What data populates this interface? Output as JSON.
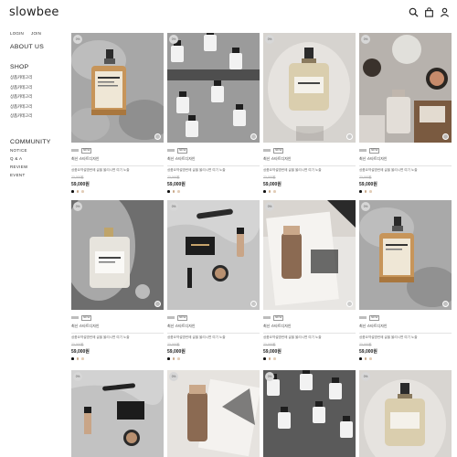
{
  "header": {
    "logo": "slowbee",
    "icons": [
      "search-icon",
      "bag-icon",
      "user-icon"
    ]
  },
  "sidebar": {
    "auth": {
      "login": "LOGIN",
      "join": "JOIN"
    },
    "about": "ABOUT US",
    "shop_title": "SHOP",
    "categories": [
      "상품카테고리",
      "상품카테고리",
      "상품카테고리",
      "상품카테고리",
      "상품카테고리"
    ],
    "community_title": "COMMUNITY",
    "community": [
      "NOTICE",
      "Q & A",
      "REVIEW",
      "EVENT"
    ]
  },
  "products": [
    {
      "badge": "0%",
      "tag": "NEW",
      "name": "최신 스타트디자인",
      "desc": "상품요약설명란에 글을 올리시면 여기 노출",
      "orig": "73,000원",
      "price": "59,000원",
      "swatches": [
        "#111111",
        "#c9a98a",
        "#e2cdb8"
      ]
    },
    {
      "badge": "0%",
      "tag": "NEW",
      "name": "최신 스타트디자인",
      "desc": "상품요약설명란에 글을 올리시면 여기 노출",
      "orig": "73,000원",
      "price": "59,000원",
      "swatches": [
        "#111111",
        "#c9a98a",
        "#e2cdb8"
      ]
    },
    {
      "badge": "0%",
      "tag": "NEW",
      "name": "최신 스타트디자인",
      "desc": "상품요약설명란에 글을 올리시면 여기 노출",
      "orig": "73,000원",
      "price": "59,000원",
      "swatches": [
        "#111111",
        "#c9a98a",
        "#e2cdb8"
      ]
    },
    {
      "badge": "0%",
      "tag": "NEW",
      "name": "최신 스타트디자인",
      "desc": "상품요약설명란에 글을 올리시면 여기 노출",
      "orig": "73,000원",
      "price": "59,000원",
      "swatches": [
        "#111111",
        "#c9a98a",
        "#e2cdb8"
      ]
    },
    {
      "badge": "0%",
      "tag": "NEW",
      "name": "최신 스타트디자인",
      "desc": "상품요약설명란에 글을 올리시면 여기 노출",
      "orig": "73,000원",
      "price": "59,000원",
      "swatches": [
        "#111111",
        "#c9a98a",
        "#e2cdb8"
      ]
    },
    {
      "badge": "0%",
      "tag": "NEW",
      "name": "최신 스타트디자인",
      "desc": "상품요약설명란에 글을 올리시면 여기 노출",
      "orig": "73,000원",
      "price": "59,000원",
      "swatches": [
        "#111111",
        "#c9a98a",
        "#e2cdb8"
      ]
    },
    {
      "badge": "0%",
      "tag": "NEW",
      "name": "최신 스타트디자인",
      "desc": "상품요약설명란에 글을 올리시면 여기 노출",
      "orig": "73,000원",
      "price": "59,000원",
      "swatches": [
        "#111111",
        "#c9a98a",
        "#e2cdb8"
      ]
    },
    {
      "badge": "0%",
      "tag": "NEW",
      "name": "최신 스타트디자인",
      "desc": "상품요약설명란에 글을 올리시면 여기 노출",
      "orig": "73,000원",
      "price": "59,000원",
      "swatches": [
        "#111111",
        "#c9a98a",
        "#e2cdb8"
      ]
    },
    {
      "badge": "0%"
    },
    {
      "badge": "0%"
    },
    {
      "badge": "0%"
    },
    {
      "badge": "0%"
    }
  ]
}
